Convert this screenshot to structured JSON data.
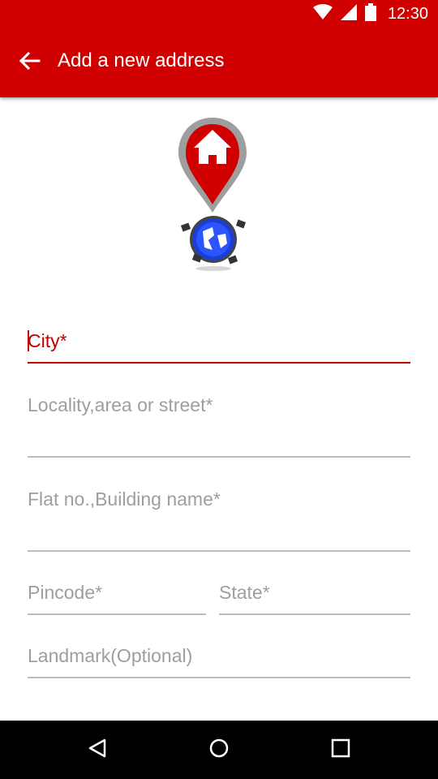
{
  "status_bar": {
    "time": "12:30",
    "icons": [
      "wifi-icon",
      "cellular-signal-icon",
      "battery-icon"
    ]
  },
  "app_bar": {
    "title": "Add a new address",
    "back_icon": "arrow-left-icon"
  },
  "hero_image": {
    "icon": "home-location-pin-with-globe-icon"
  },
  "form": {
    "city": {
      "placeholder": "City*",
      "value": ""
    },
    "locality": {
      "placeholder": "Locality,area or street*",
      "value": ""
    },
    "flat": {
      "placeholder": "Flat no.,Building name*",
      "value": ""
    },
    "pincode": {
      "placeholder": "Pincode*",
      "value": ""
    },
    "state": {
      "placeholder": "State*",
      "value": ""
    },
    "landmark": {
      "placeholder": "Landmark(Optional)",
      "value": ""
    }
  },
  "nav_bar": {
    "icons": [
      "back-triangle-icon",
      "home-circle-icon",
      "recents-square-icon"
    ]
  },
  "colors": {
    "primary": "#d10000",
    "accent": "#c40000",
    "hint": "#9e9e9e",
    "underline": "#bdbdbd"
  }
}
